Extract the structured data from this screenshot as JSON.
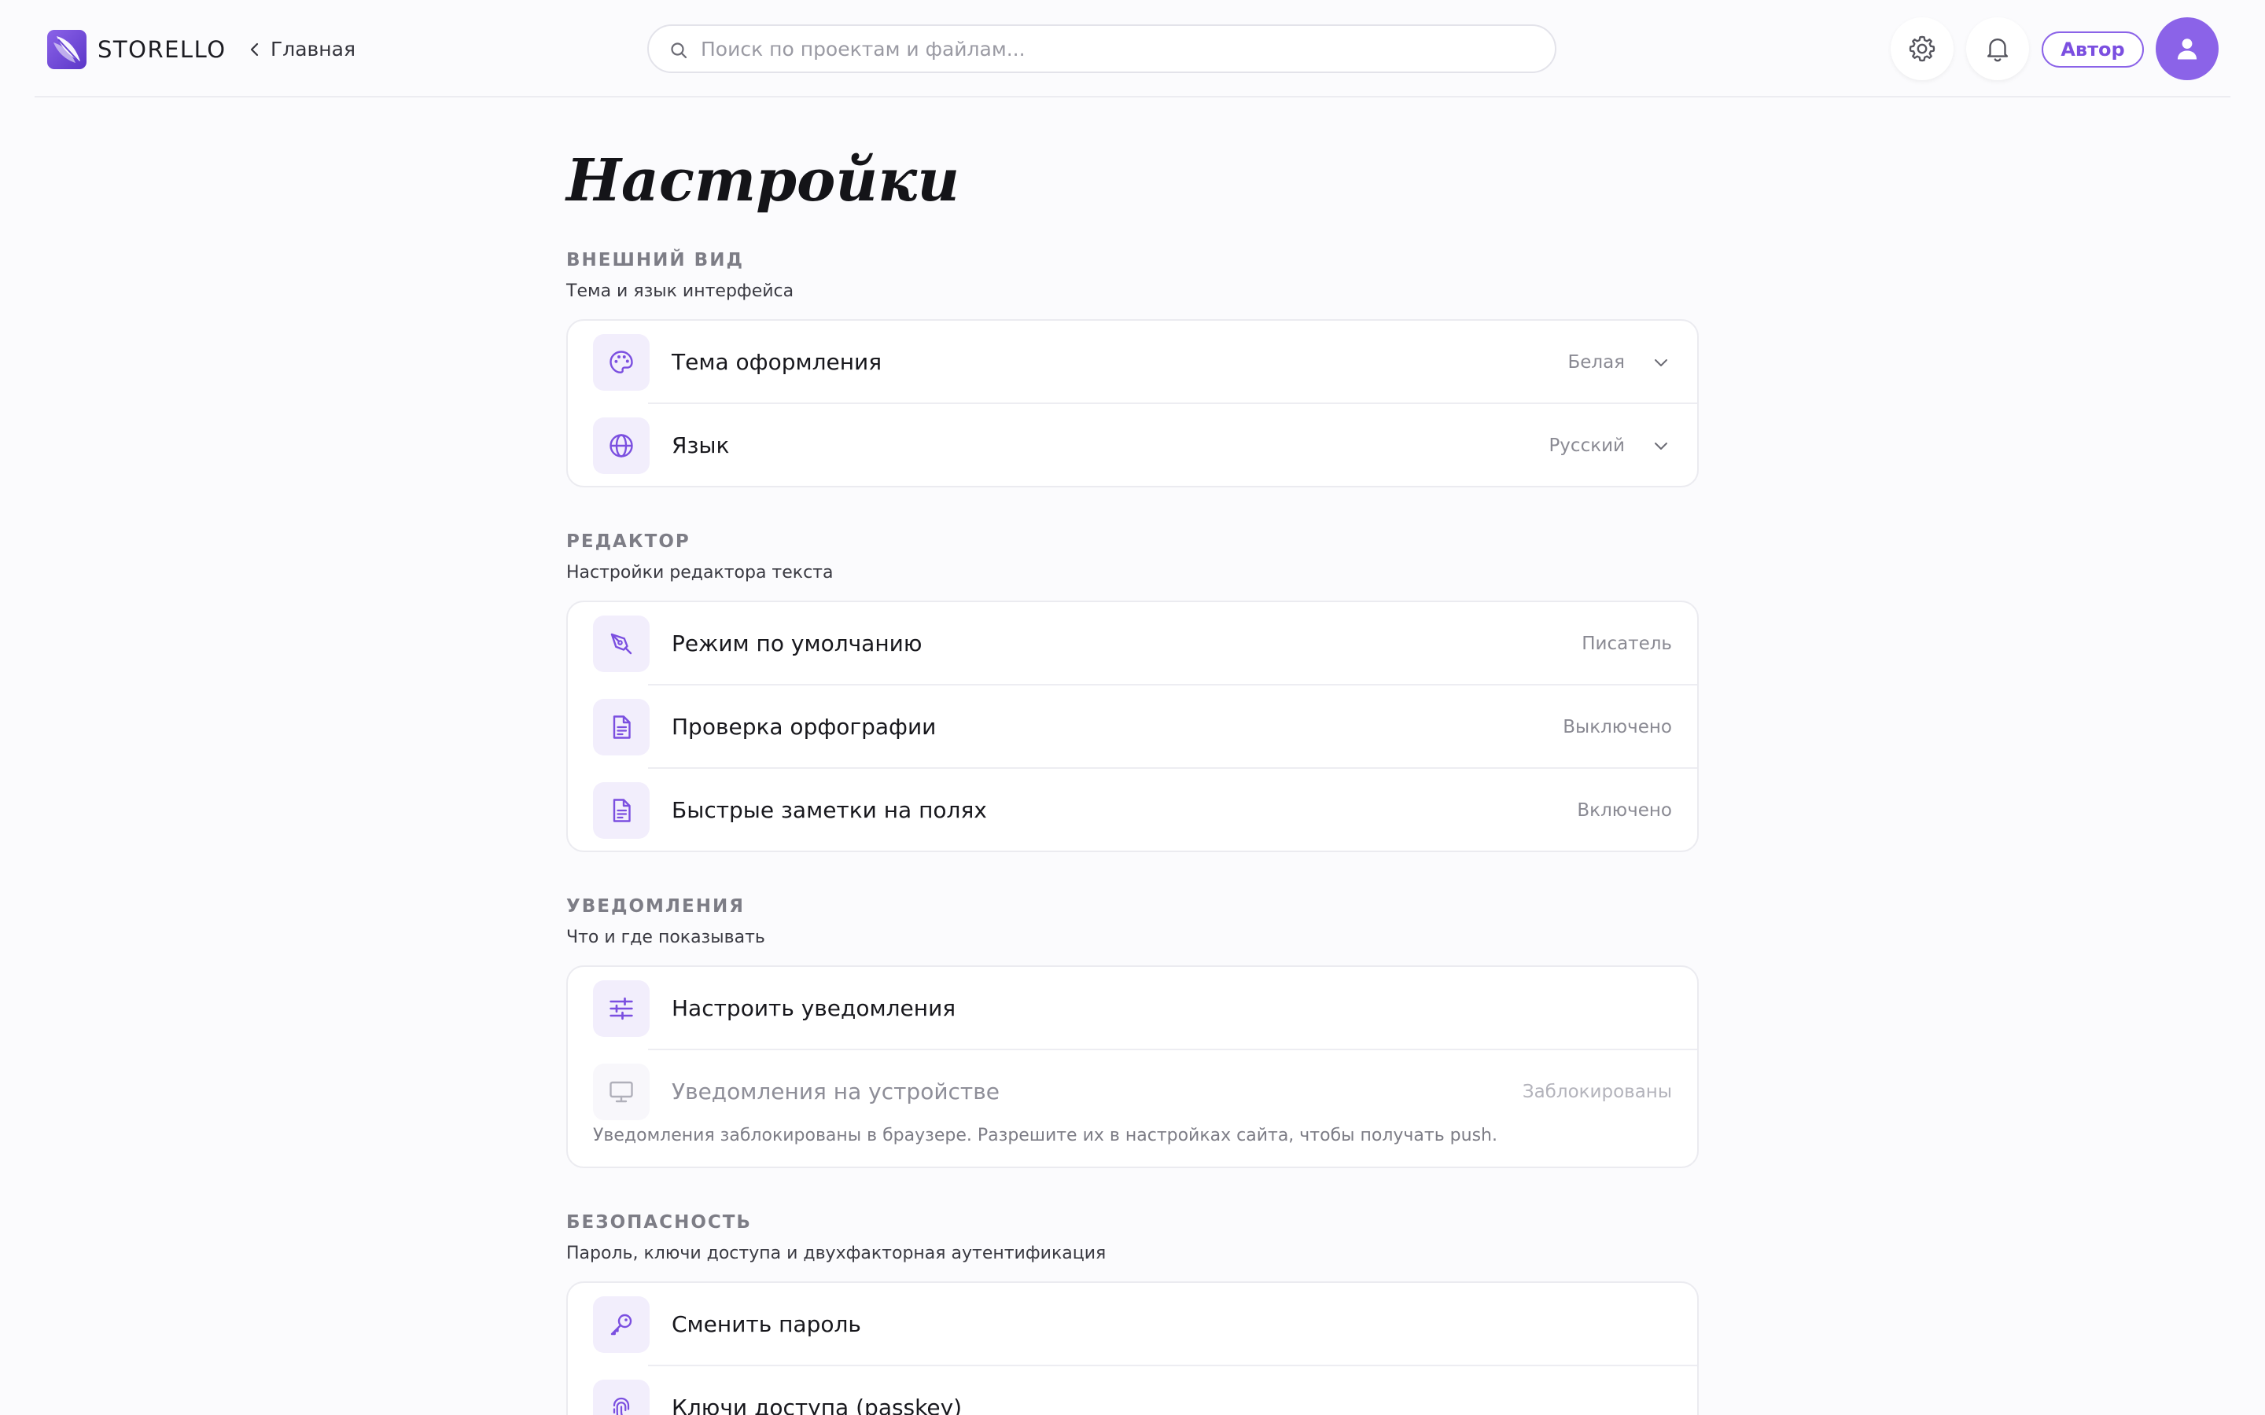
{
  "header": {
    "brand": "STORELLO",
    "back_label": "Главная",
    "search_placeholder": "Поиск по проектам и файлам...",
    "role_badge": "Автор"
  },
  "page_title": "Настройки",
  "sections": {
    "appearance": {
      "title": "ВНЕШНИЙ ВИД",
      "subtitle": "Тема и язык интерфейса",
      "rows": [
        {
          "label": "Тема оформления",
          "value": "Белая",
          "icon": "palette-icon"
        },
        {
          "label": "Язык",
          "value": "Русский",
          "icon": "globe-icon"
        }
      ]
    },
    "editor": {
      "title": "РЕДАКТОР",
      "subtitle": "Настройки редактора текста",
      "rows": [
        {
          "label": "Режим по умолчанию",
          "value": "Писатель",
          "icon": "pen-tool-icon"
        },
        {
          "label": "Проверка орфографии",
          "value": "Выключено",
          "icon": "document-icon"
        },
        {
          "label": "Быстрые заметки на полях",
          "value": "Включено",
          "icon": "document-icon"
        }
      ]
    },
    "notifications": {
      "title": "УВЕДОМЛЕНИЯ",
      "subtitle": "Что и где показывать",
      "rows": [
        {
          "label": "Настроить уведомления",
          "value": "",
          "icon": "sliders-icon"
        },
        {
          "label": "Уведомления на устройстве",
          "value": "Заблокированы",
          "icon": "monitor-icon"
        }
      ],
      "note": "Уведомления заблокированы в браузере. Разрешите их в настройках сайта, чтобы получать push."
    },
    "security": {
      "title": "БЕЗОПАСНОСТЬ",
      "subtitle": "Пароль, ключи доступа и двухфакторная аутентификация",
      "rows": [
        {
          "label": "Сменить пароль",
          "value": "",
          "icon": "key-icon"
        },
        {
          "label": "Ключи доступа (passkey)",
          "value": "",
          "icon": "fingerprint-icon"
        }
      ]
    }
  },
  "colors": {
    "accent": "#8b63e8",
    "accent_dark": "#5b36c8",
    "icon_bg": "#f2eefc",
    "background": "#fbfbfd"
  }
}
